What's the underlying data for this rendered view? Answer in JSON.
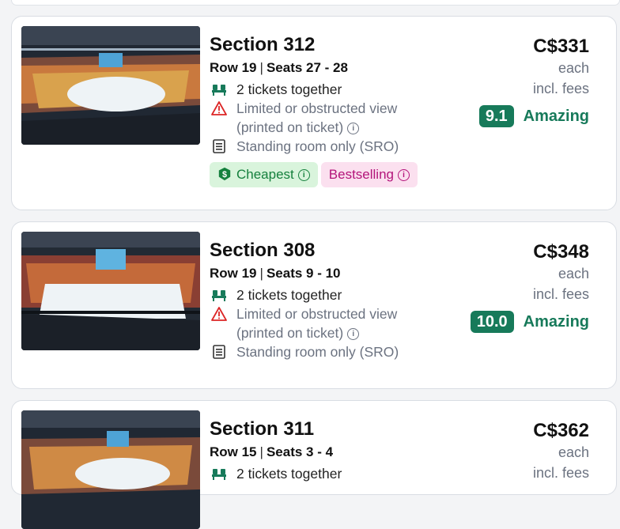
{
  "listings": [
    {
      "section": "Section 312",
      "row": "Row 19",
      "seats": "Seats 27 - 28",
      "features": [
        {
          "icon": "seats-icon",
          "text": "2 tickets together"
        },
        {
          "icon": "warning-icon",
          "text": "Limited or obstructed view"
        },
        {
          "icon": "",
          "text": "(printed on ticket)"
        },
        {
          "icon": "list-icon",
          "text": "Standing room only (SRO)"
        }
      ],
      "tags": [
        {
          "label": "Cheapest",
          "icon": "dollar-badge-icon"
        },
        {
          "label": "Bestselling"
        }
      ],
      "price": "C$331",
      "price_unit": "each",
      "price_note": "incl. fees",
      "score": "9.1",
      "rating": "Amazing"
    },
    {
      "section": "Section 308",
      "row": "Row 19",
      "seats": "Seats 9 - 10",
      "features": [
        {
          "icon": "seats-icon",
          "text": "2 tickets together"
        },
        {
          "icon": "warning-icon",
          "text": "Limited or obstructed view"
        },
        {
          "icon": "",
          "text": "(printed on ticket)"
        },
        {
          "icon": "list-icon",
          "text": "Standing room only (SRO)"
        }
      ],
      "price": "C$348",
      "price_unit": "each",
      "price_note": "incl. fees",
      "score": "10.0",
      "rating": "Amazing"
    },
    {
      "section": "Section 311",
      "row": "Row 15",
      "seats": "Seats 3 - 4",
      "features": [
        {
          "icon": "seats-icon",
          "text": "2 tickets together"
        }
      ],
      "price": "C$362",
      "price_unit": "each",
      "price_note": "incl. fees"
    }
  ],
  "colors": {
    "accent_green": "#177a5a",
    "cheapest_bg": "#d9f4dc",
    "cheapest_text": "#15803d",
    "bestselling_bg": "#fbe0ef",
    "bestselling_text": "#b3147a",
    "warning_red": "#dc2626"
  }
}
